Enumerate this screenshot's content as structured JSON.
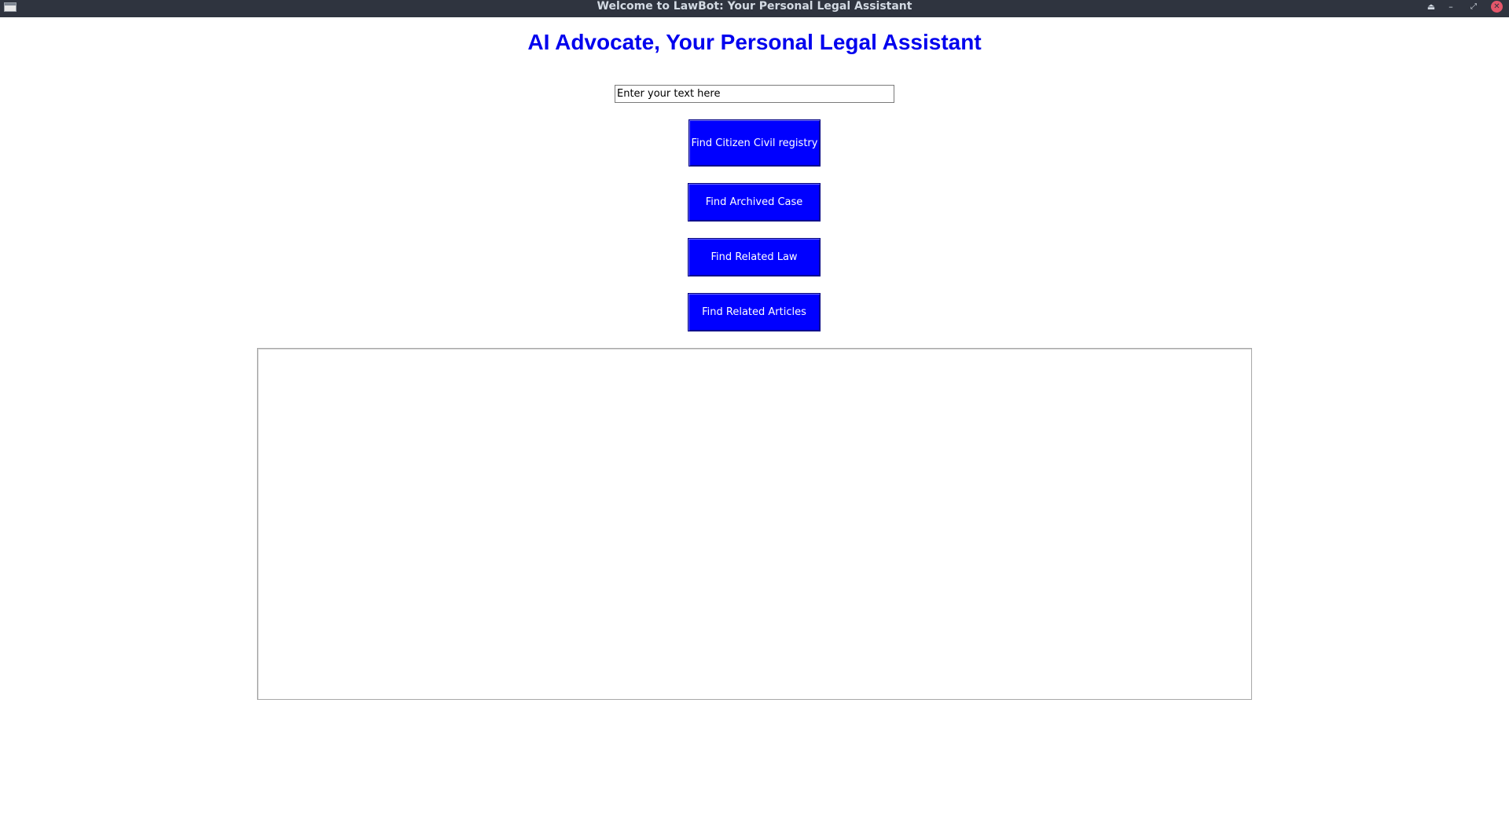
{
  "window": {
    "title": "Welcome to LawBot: Your Personal Legal Assistant",
    "controls": {
      "eject_glyph": "⏏",
      "minimize_glyph": "–",
      "maximize_glyph": "⤢",
      "close_glyph": "✕"
    }
  },
  "main": {
    "heading": "AI Advocate, Your Personal Legal Assistant",
    "input": {
      "value": "Enter your text here"
    },
    "buttons": {
      "civil_registry": "Find Citizen Civil registry",
      "archived_case": "Find Archived Case",
      "related_law": "Find Related Law",
      "related_articles": "Find Related Articles"
    },
    "output": {
      "value": ""
    }
  },
  "colors": {
    "titlebar": "#2f343f",
    "heading": "#0000ee",
    "button_bg": "#0000ff",
    "button_text": "#ffffff",
    "close_button": "#e4566a"
  }
}
